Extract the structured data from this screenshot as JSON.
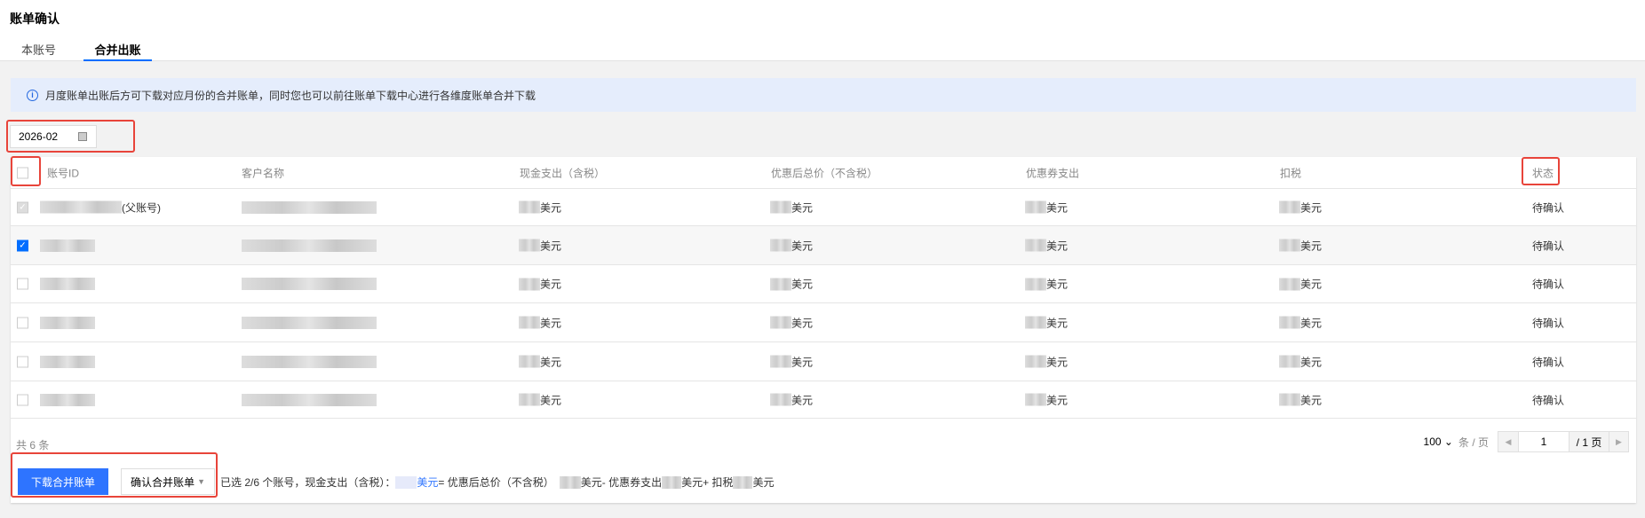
{
  "page_title": "账单确认",
  "tabs": [
    {
      "label": "本账号",
      "active": false
    },
    {
      "label": "合并出账",
      "active": true
    }
  ],
  "info": "月度账单出账后方可下载对应月份的合并账单，同时您也可以前往账单下载中心进行各维度账单合并下载",
  "date_picker": {
    "value": "2026-02",
    "icon": "calendar-icon"
  },
  "table": {
    "columns": [
      "账号ID",
      "客户名称",
      "现金支出（含税）",
      "优惠后总价（不含税）",
      "优惠券支出",
      "扣税",
      "状态"
    ],
    "rows": [
      {
        "checked": true,
        "disabled": true,
        "id_suffix": "(父账号)",
        "unit": "美元",
        "status": "待确认"
      },
      {
        "checked": true,
        "disabled": false,
        "id_suffix": "",
        "unit": "美元",
        "status": "待确认"
      },
      {
        "checked": false,
        "disabled": false,
        "id_suffix": "",
        "unit": "美元",
        "status": "待确认"
      },
      {
        "checked": false,
        "disabled": false,
        "id_suffix": "",
        "unit": "美元",
        "status": "待确认"
      },
      {
        "checked": false,
        "disabled": false,
        "id_suffix": "",
        "unit": "美元",
        "status": "待确认"
      },
      {
        "checked": false,
        "disabled": false,
        "id_suffix": "",
        "unit": "美元",
        "status": "待确认"
      }
    ]
  },
  "footer": {
    "total": "共 6 条",
    "page_size": "100",
    "per_page": "条 / 页",
    "page": "1",
    "total_pages": "/ 1 页"
  },
  "actions": {
    "download": "下载合并账单",
    "confirm": "确认合并账单"
  },
  "summary": {
    "selected": "已选 2/6 个账号，现金支出（含税）：",
    "unit": "美元",
    "eq": " = 优惠后总价（不含税）",
    "minus": " - 优惠券支出",
    "plus": " + 扣税"
  },
  "colors": {
    "accent": "#006eff",
    "highlight": "#e8443a"
  }
}
